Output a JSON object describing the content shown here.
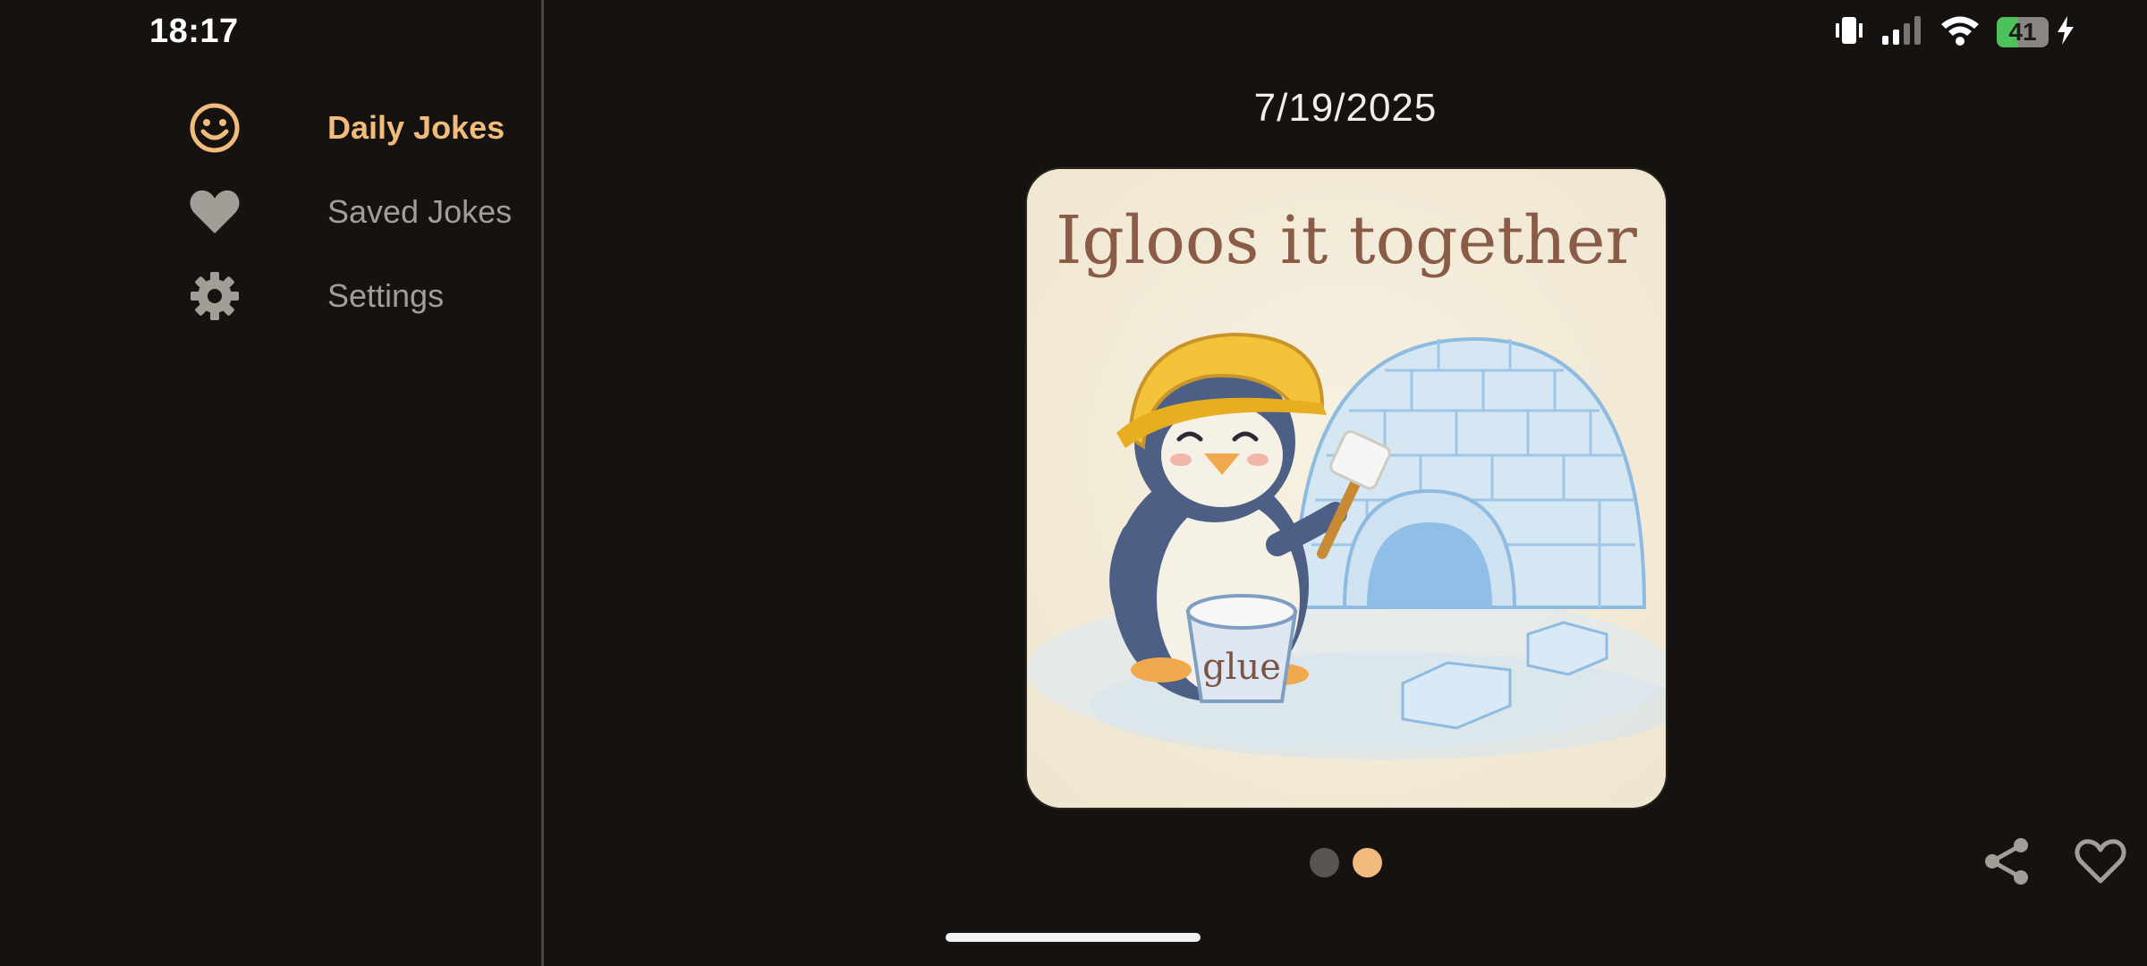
{
  "status_bar": {
    "time": "18:17",
    "battery_level": "41",
    "battery_fraction": 0.41,
    "charging": true,
    "icons": [
      "vibrate-icon",
      "cellular-signal-icon",
      "wifi-icon",
      "battery-icon",
      "charging-bolt-icon"
    ]
  },
  "sidebar": {
    "items": [
      {
        "label": "Daily Jokes",
        "icon": "smiley-icon",
        "active": true
      },
      {
        "label": "Saved Jokes",
        "icon": "heart-icon",
        "active": false
      },
      {
        "label": "Settings",
        "icon": "gear-icon",
        "active": false
      }
    ]
  },
  "main": {
    "date": "7/19/2025",
    "joke_image": {
      "caption": "Igloos it together",
      "bucket_label": "glue"
    },
    "pagination": {
      "total": 2,
      "current": 2
    },
    "actions": {
      "share_icon": "share-icon",
      "save_icon": "heart-outline-icon"
    }
  },
  "colors": {
    "background": "#16120f",
    "accent": "#f0bb7c",
    "inactive": "#a39d97",
    "battery_fill": "#4ec25a"
  }
}
